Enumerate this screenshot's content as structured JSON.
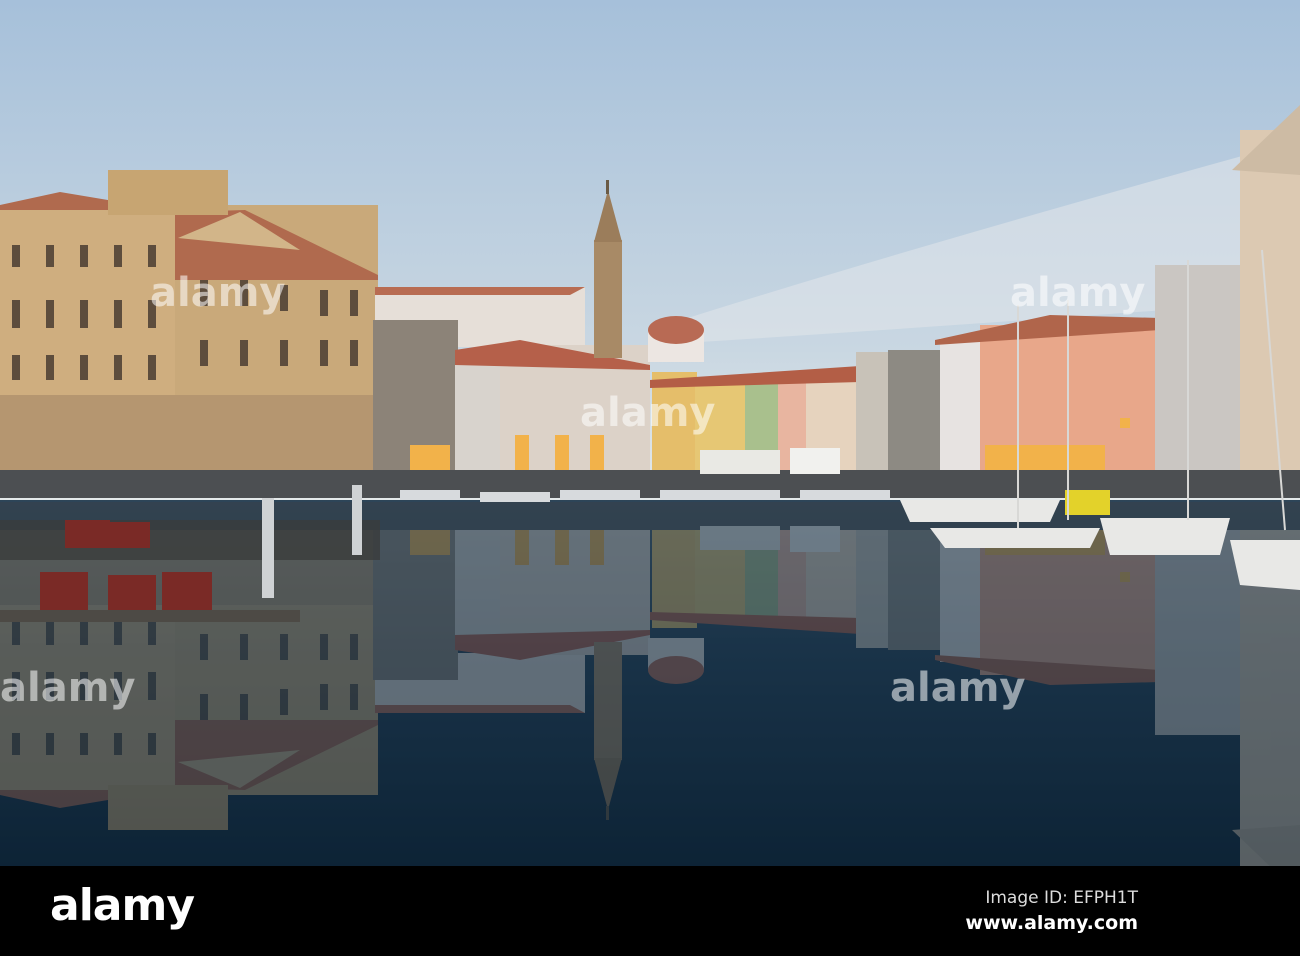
{
  "watermark": {
    "brand": "alamy",
    "center_text": "alamy"
  },
  "footer": {
    "logo": "alamy",
    "image_id": "Image ID: EFPH1T",
    "url": "www.alamy.com"
  },
  "colors": {
    "sky_top": "#a8c2dc",
    "sky_horizon": "#e2e8ea",
    "water_top": "#3b5468",
    "water_bottom": "#0d2436"
  }
}
